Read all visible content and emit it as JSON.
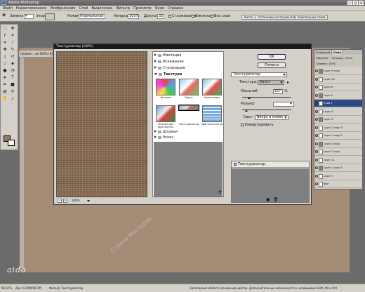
{
  "app": {
    "title": "Adobe Photoshop"
  },
  "menu": [
    "Файл",
    "Редактирование",
    "Изображение",
    "Слой",
    "Выделение",
    "Фильтр",
    "Просмотр",
    "Окно",
    "Справка"
  ],
  "options": {
    "wand_label": "Замена",
    "mode_label": "Узор",
    "mode2_label": "Режим:",
    "mode_value": "Нормальный",
    "opacity_label": "Непрозр.",
    "opacity_value": "100%",
    "tolerance_label": "Допуск:",
    "tolerance_value": "32",
    "smooth_label": "Сглаживание",
    "contig_label": "Смежные",
    "all_layers_label": "Все слои",
    "tab_brushes": "Кисти",
    "tab_presets": "Установки инструментов",
    "tab_comps": "Композиции слоев"
  },
  "document": {
    "tab_title": "Снимок ...пи 100% (RGB/8)"
  },
  "dialog": {
    "title": "Текстуризатор (100%)",
    "ok_label": "OK",
    "cancel_label": "Отмена",
    "zoom": "100%",
    "zoom_minus": "−",
    "zoom_plus": "+",
    "categories": [
      {
        "name": "Имитация",
        "open": false
      },
      {
        "name": "Искажение",
        "open": false
      },
      {
        "name": "Стилизация",
        "open": false
      },
      {
        "name": "Текстура",
        "open": true
      },
      {
        "name": "Штрихи",
        "open": false
      },
      {
        "name": "Эскиз",
        "open": false
      }
    ],
    "thumbs": [
      "Витраж",
      "Зерно",
      "Кракелюры",
      "Мозаичные фрагменты",
      "Текстуризатор",
      "Цветная плитка"
    ],
    "selected_thumb": 4,
    "filter_select": "Текстуризатор",
    "texture_label": "Текстура:",
    "texture_value": "Холст",
    "scale_label": "Масштаб",
    "scale_value": "107",
    "scale_unit": "%",
    "scale_level": 0.14,
    "relief_label": "Рельеф",
    "relief_value": "4",
    "relief_level": 0.08,
    "light_label": "Свет:",
    "light_value": "Вверх и влево",
    "invert_label": "Инвертировать",
    "layer_item": "Текстуризатор"
  },
  "layers_panel": {
    "tabs": [
      "Операции",
      "Слои"
    ],
    "blend": "Обычные",
    "opacity": "Непрозр.: 100%",
    "fill": "Заливка: 100%",
    "rows": [
      "Layer 9 copy",
      "Layer 10",
      "Layer 8",
      "Layer 5",
      "Слой 1",
      "Layer 4",
      "Layer 3",
      "Layer 1 copy 3",
      "Layer 1 copy 2",
      "Layer 3 copy",
      "Layer 1 copy",
      "Layer 11",
      "Layer 1 copy 4",
      "Layer 7",
      "Фон"
    ],
    "active_index": 4
  },
  "status": {
    "zoom": "66.67%",
    "doc": "Док: 9,29M/90,3M",
    "hint": "Фильтр Текстуризатор",
    "help": "Заполнение области основным цветом. Дополнительные возможности с клавишами Shift, Alt и Ctrl."
  },
  "watermark": "Страна Мастеров",
  "signature": "aida",
  "colors": {
    "canvas": "#a48c76",
    "texture": "#8a6e54",
    "ui": "#d4d0c8"
  }
}
